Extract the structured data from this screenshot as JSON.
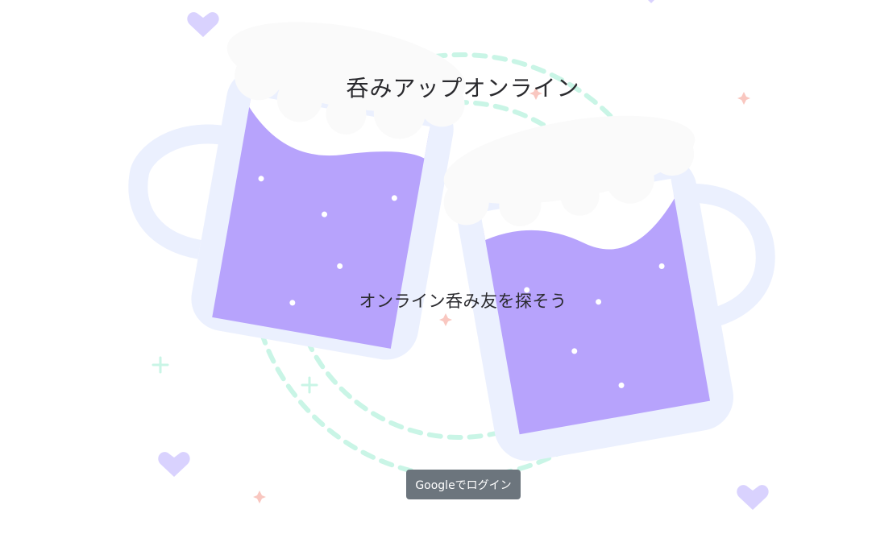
{
  "app": {
    "title": "呑みアップオンライン",
    "tagline": "オンライン呑み友を探そう"
  },
  "actions": {
    "login_label": "Googleでログイン"
  },
  "illustration": {
    "subject": "two-beer-mugs-toasting",
    "icons": [
      "heart-icon",
      "sparkle-icon",
      "plus-icon"
    ]
  },
  "colors": {
    "beer": "#b7a3fc",
    "mug": "#ebf0fe",
    "foam": "#fafafa",
    "heart": "#d9d2fe",
    "dashed_circle": "#c9f5e6",
    "sparkle": "#f9c7c0",
    "button": "#6c757d",
    "text": "#2a2a2e"
  }
}
